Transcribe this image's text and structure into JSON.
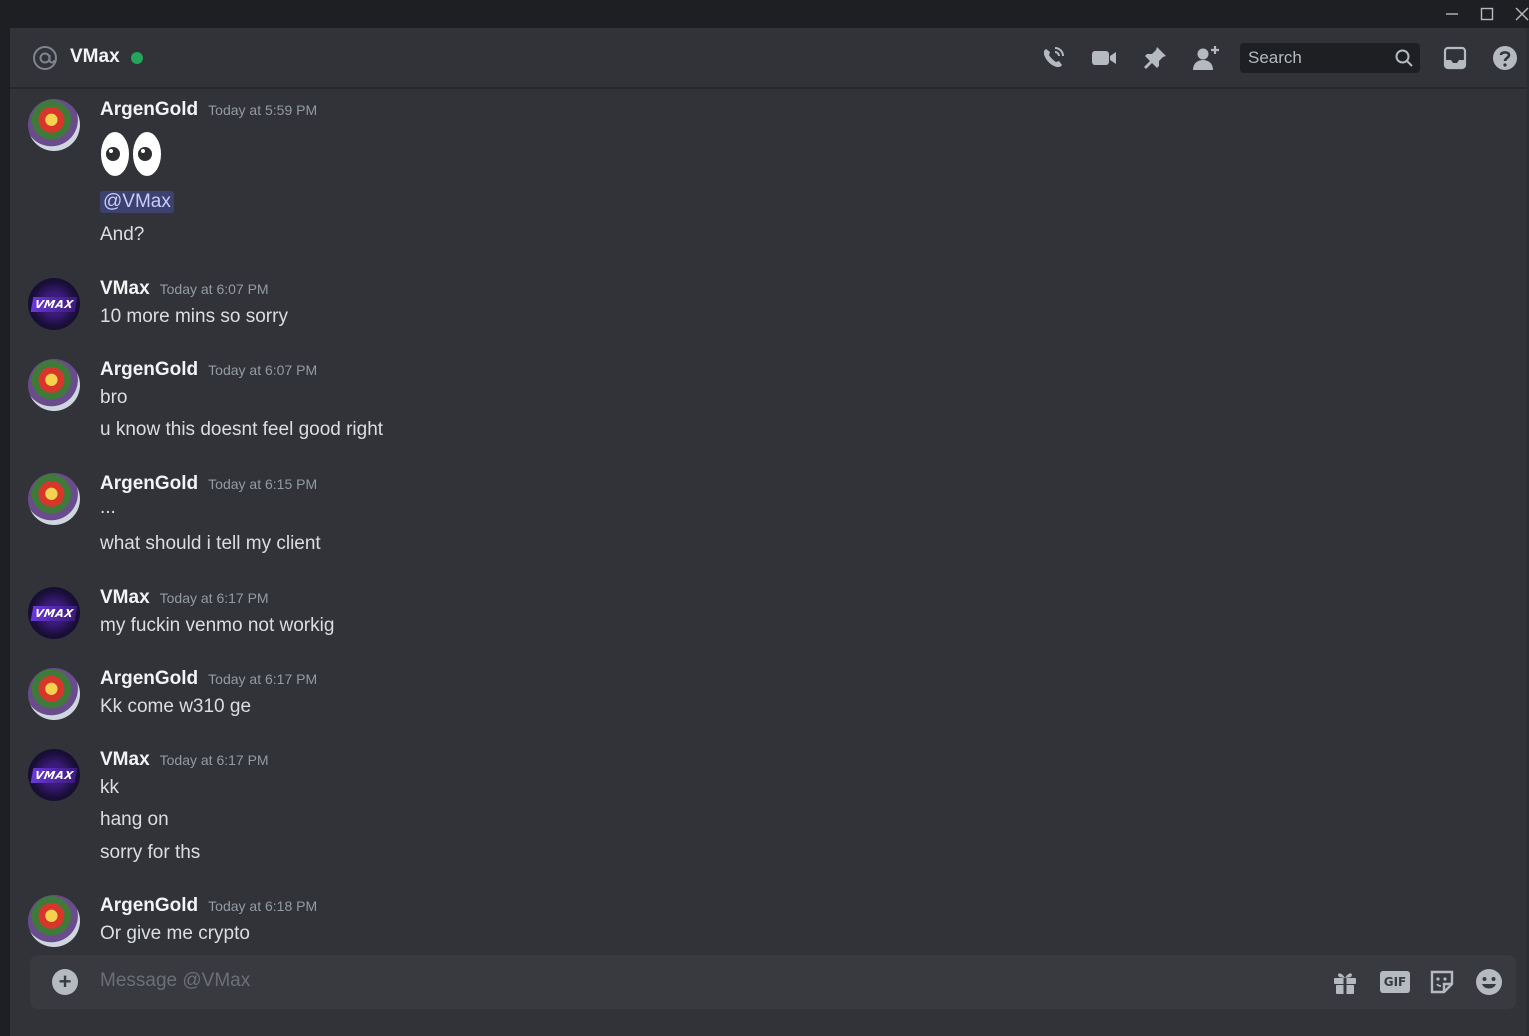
{
  "window": {
    "minimize_label": "–",
    "maximize_label": "☐",
    "close_label": "✕"
  },
  "header": {
    "channel_name": "VMax",
    "status": "online",
    "status_color": "#23a55a",
    "icons": [
      "call-icon",
      "video-icon",
      "pin-icon",
      "add-friend-icon"
    ],
    "search_placeholder": "Search",
    "right_icons": [
      "inbox-icon",
      "help-icon"
    ]
  },
  "messages": [
    {
      "author": "ArgenGold",
      "time": "Today at 5:59 PM",
      "avatar": "argengold",
      "emoji": "eyes",
      "mention": "@VMax",
      "lines": [
        "And?"
      ]
    },
    {
      "author": "VMax",
      "time": "Today at 6:07 PM",
      "avatar": "vmax",
      "lines": [
        "10 more mins so sorry"
      ]
    },
    {
      "author": "ArgenGold",
      "time": "Today at 6:07 PM",
      "avatar": "argengold",
      "lines": [
        "bro",
        "u know this doesnt feel good right"
      ]
    },
    {
      "author": "ArgenGold",
      "time": "Today at 6:15 PM",
      "avatar": "argengold",
      "lines": [
        "...",
        "what should i tell my client"
      ]
    },
    {
      "author": "VMax",
      "time": "Today at 6:17 PM",
      "avatar": "vmax",
      "lines": [
        "my fuckin venmo not workig"
      ]
    },
    {
      "author": "ArgenGold",
      "time": "Today at 6:17 PM",
      "avatar": "argengold",
      "lines": [
        "Kk come w310 ge"
      ]
    },
    {
      "author": "VMax",
      "time": "Today at 6:17 PM",
      "avatar": "vmax",
      "lines": [
        "kk",
        "hang on",
        "sorry for ths"
      ]
    },
    {
      "author": "ArgenGold",
      "time": "Today at 6:18 PM",
      "avatar": "argengold",
      "lines": [
        "Or give me crypto"
      ]
    }
  ],
  "vmax_avatar_text": "VMAX",
  "composer": {
    "placeholder": "Message @VMax",
    "gif_label": "GIF",
    "icons": [
      "gift-icon",
      "gif-icon",
      "sticker-icon",
      "emoji-icon"
    ]
  }
}
